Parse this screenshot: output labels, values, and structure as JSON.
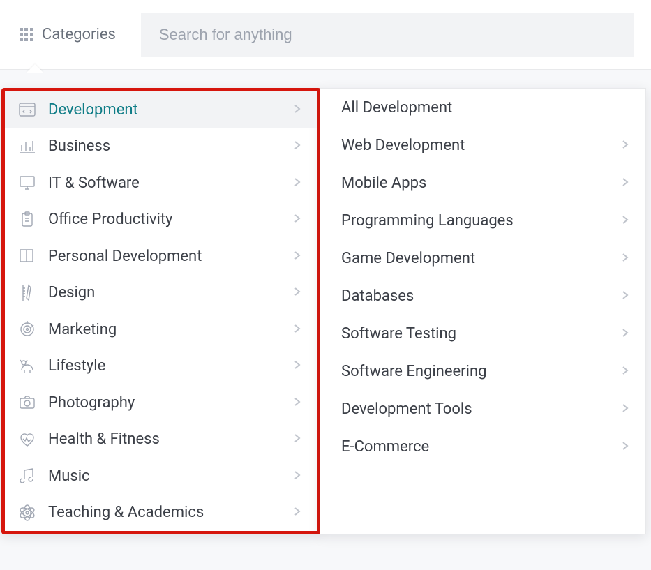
{
  "topbar": {
    "categories_label": "Categories",
    "search_placeholder": "Search for anything"
  },
  "categories": [
    {
      "icon": "code",
      "label": "Development",
      "active": true,
      "chevron": true
    },
    {
      "icon": "bar-chart",
      "label": "Business",
      "active": false,
      "chevron": true
    },
    {
      "icon": "monitor",
      "label": "IT & Software",
      "active": false,
      "chevron": true
    },
    {
      "icon": "clipboard",
      "label": "Office Productivity",
      "active": false,
      "chevron": true
    },
    {
      "icon": "book",
      "label": "Personal Development",
      "active": false,
      "chevron": true
    },
    {
      "icon": "ruler",
      "label": "Design",
      "active": false,
      "chevron": true
    },
    {
      "icon": "target",
      "label": "Marketing",
      "active": false,
      "chevron": true
    },
    {
      "icon": "dog",
      "label": "Lifestyle",
      "active": false,
      "chevron": true
    },
    {
      "icon": "camera",
      "label": "Photography",
      "active": false,
      "chevron": true
    },
    {
      "icon": "heart",
      "label": "Health & Fitness",
      "active": false,
      "chevron": true
    },
    {
      "icon": "music",
      "label": "Music",
      "active": false,
      "chevron": true
    },
    {
      "icon": "atom",
      "label": "Teaching & Academics",
      "active": false,
      "chevron": true
    }
  ],
  "subcategories": [
    {
      "label": "All Development",
      "chevron": false
    },
    {
      "label": "Web Development",
      "chevron": true
    },
    {
      "label": "Mobile Apps",
      "chevron": true
    },
    {
      "label": "Programming Languages",
      "chevron": true
    },
    {
      "label": "Game Development",
      "chevron": true
    },
    {
      "label": "Databases",
      "chevron": true
    },
    {
      "label": "Software Testing",
      "chevron": true
    },
    {
      "label": "Software Engineering",
      "chevron": true
    },
    {
      "label": "Development Tools",
      "chevron": true
    },
    {
      "label": "E-Commerce",
      "chevron": true
    }
  ]
}
